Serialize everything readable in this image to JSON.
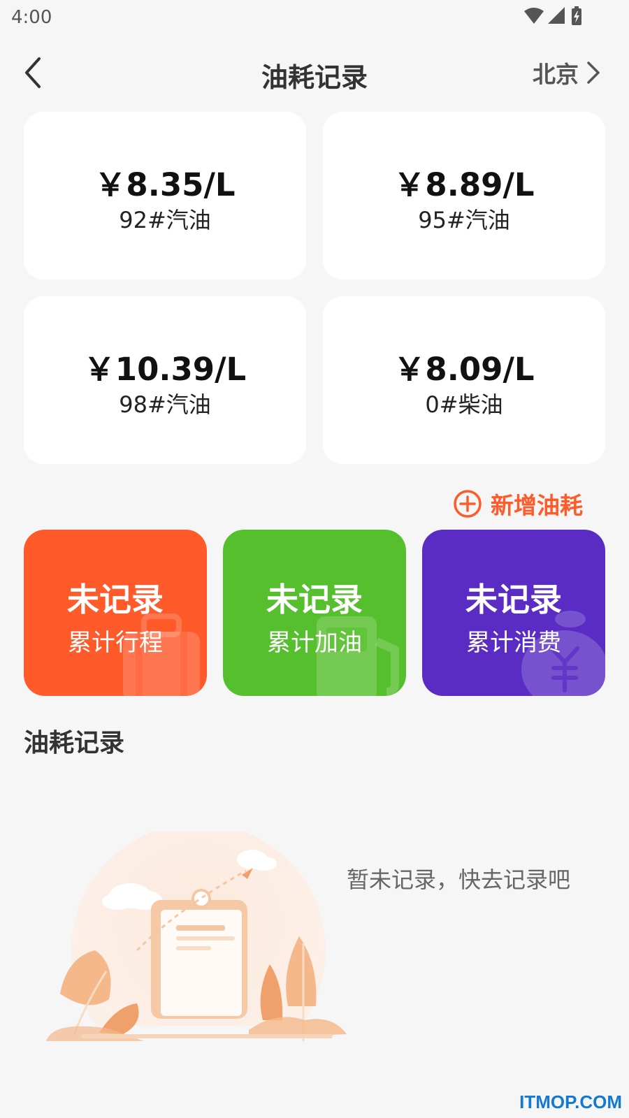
{
  "status_bar": {
    "time": "4:00",
    "icons": [
      "wifi-icon",
      "signal-icon",
      "battery-icon"
    ]
  },
  "header": {
    "title": "油耗记录",
    "city": "北京",
    "back_icon": "chevron-left-icon",
    "city_icon": "chevron-right-icon"
  },
  "prices": [
    {
      "value": "￥8.35/L",
      "type": "92#汽油"
    },
    {
      "value": "￥8.89/L",
      "type": "95#汽油"
    },
    {
      "value": "￥10.39/L",
      "type": "98#汽油"
    },
    {
      "value": "￥8.09/L",
      "type": "0#柴油"
    }
  ],
  "add_record": {
    "label": "新增油耗",
    "icon": "plus-circle-icon",
    "color": "#ff5a2a"
  },
  "stats": [
    {
      "value": "未记录",
      "label": "累计行程",
      "color": "#ff5a2a",
      "icon": "luggage-icon"
    },
    {
      "value": "未记录",
      "label": "累计加油",
      "color": "#56bf2d",
      "icon": "fuel-pump-icon"
    },
    {
      "value": "未记录",
      "label": "累计消费",
      "color": "#5a2cc4",
      "icon": "money-bag-icon"
    }
  ],
  "records": {
    "section_title": "油耗记录",
    "empty_text": "暂未记录，快去记录吧"
  },
  "watermark": "ITMOP.COM"
}
